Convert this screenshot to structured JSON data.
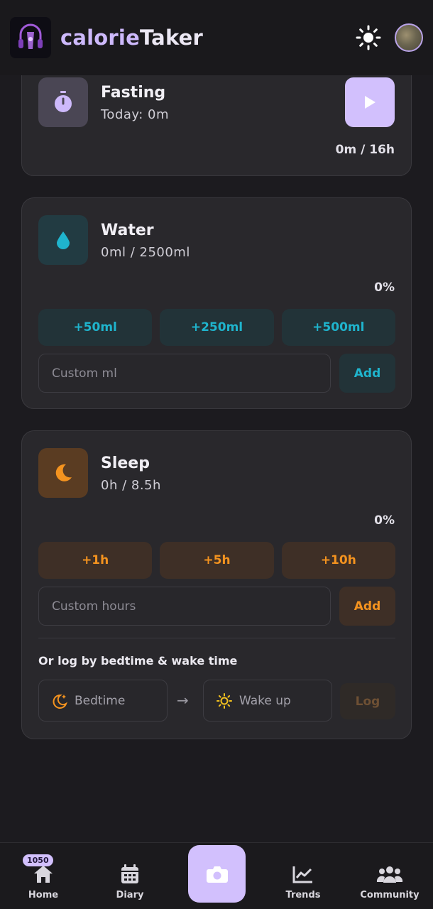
{
  "header": {
    "title_part1": "calorie",
    "title_part2": "Taker",
    "logo_icon": "headphones-logo-icon",
    "theme_icon": "sun-icon",
    "avatar_icon": "user-avatar"
  },
  "fasting": {
    "title": "Fasting",
    "subtitle": "Today: 0m",
    "progress": "0m / 16h",
    "icon": "stopwatch-icon",
    "play_icon": "play-icon"
  },
  "water": {
    "title": "Water",
    "subtitle": "0ml / 2500ml",
    "percent": "0%",
    "quick_add": [
      "+50ml",
      "+250ml",
      "+500ml"
    ],
    "custom_placeholder": "Custom ml",
    "add_label": "Add",
    "icon": "water-drop-icon"
  },
  "sleep": {
    "title": "Sleep",
    "subtitle": "0h / 8.5h",
    "percent": "0%",
    "quick_add": [
      "+1h",
      "+5h",
      "+10h"
    ],
    "custom_placeholder": "Custom hours",
    "add_label": "Add",
    "icon": "moon-icon",
    "log_section_label": "Or log by bedtime & wake time",
    "bedtime_label": "Bedtime",
    "wakeup_label": "Wake up",
    "log_label": "Log"
  },
  "nav": {
    "items": [
      {
        "label": "Home",
        "icon": "home-icon",
        "badge": "1050"
      },
      {
        "label": "Diary",
        "icon": "calendar-icon"
      },
      {
        "label": "Trends",
        "icon": "trend-chart-icon"
      },
      {
        "label": "Community",
        "icon": "people-icon"
      }
    ],
    "camera_icon": "camera-icon"
  },
  "colors": {
    "accent": "#d2c0fd",
    "water": "#1fb4cd",
    "sleep": "#f4931f",
    "background": "#1c1b1f",
    "card": "#29282c"
  }
}
